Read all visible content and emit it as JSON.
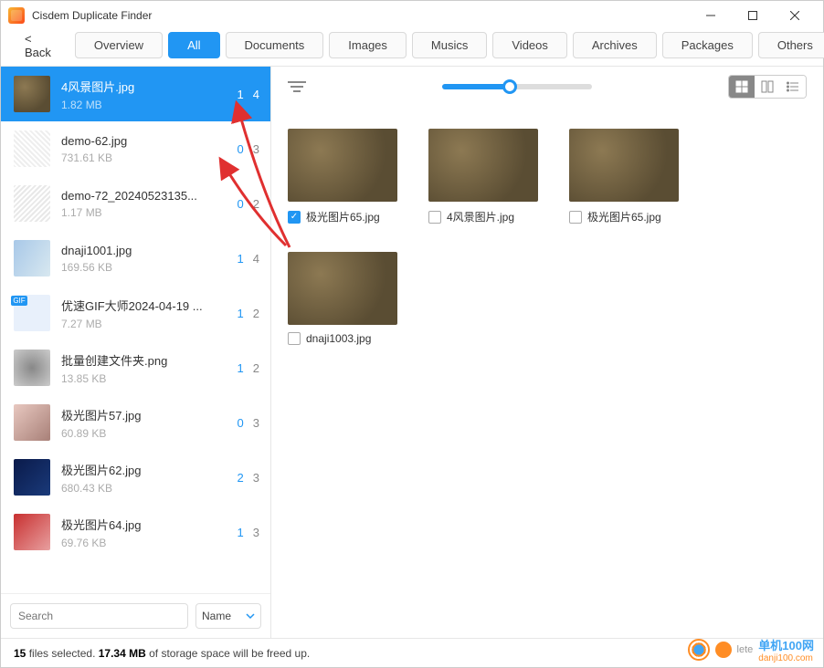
{
  "window": {
    "title": "Cisdem Duplicate Finder"
  },
  "toolbar": {
    "back": "< Back",
    "tabs": [
      "Overview",
      "All",
      "Documents",
      "Images",
      "Musics",
      "Videos",
      "Archives",
      "Packages",
      "Others"
    ],
    "active_index": 1
  },
  "sidebar": {
    "items": [
      {
        "name": "4风景图片.jpg",
        "size": "1.82 MB",
        "c1": "1",
        "c2": "4",
        "thumb": "bg-scenery",
        "selected": true
      },
      {
        "name": "demo-62.jpg",
        "size": "731.61 KB",
        "c1": "0",
        "c2": "3",
        "thumb": "bg-noise1"
      },
      {
        "name": "demo-72_20240523135...",
        "size": "1.17 MB",
        "c1": "0",
        "c2": "2",
        "thumb": "bg-noise2"
      },
      {
        "name": "dnaji1001.jpg",
        "size": "169.56 KB",
        "c1": "1",
        "c2": "4",
        "thumb": "bg-person"
      },
      {
        "name": "优速GIF大师2024-04-19 ...",
        "size": "7.27 MB",
        "c1": "1",
        "c2": "2",
        "thumb": "bg-gif"
      },
      {
        "name": "批量创建文件夹.png",
        "size": "13.85 KB",
        "c1": "1",
        "c2": "2",
        "thumb": "bg-folder"
      },
      {
        "name": "极光图片57.jpg",
        "size": "60.89 KB",
        "c1": "0",
        "c2": "3",
        "thumb": "bg-girl"
      },
      {
        "name": "极光图片62.jpg",
        "size": "680.43 KB",
        "c1": "2",
        "c2": "3",
        "thumb": "bg-concert"
      },
      {
        "name": "极光图片64.jpg",
        "size": "69.76 KB",
        "c1": "1",
        "c2": "3",
        "thumb": "bg-red"
      }
    ],
    "search_placeholder": "Search",
    "sort_label": "Name"
  },
  "grid": {
    "items": [
      {
        "label": "极光图片65.jpg",
        "checked": true
      },
      {
        "label": "4风景图片.jpg",
        "checked": false
      },
      {
        "label": "极光图片65.jpg",
        "checked": false
      },
      {
        "label": "dnaji1003.jpg",
        "checked": false
      }
    ]
  },
  "status": {
    "count": "15",
    "t1": " files selected.  ",
    "size": "17.34 MB",
    "t2": "  of storage space will be freed up."
  },
  "watermark": {
    "lete": "lete",
    "brand": "单机100网",
    "url": "danji100.com"
  }
}
